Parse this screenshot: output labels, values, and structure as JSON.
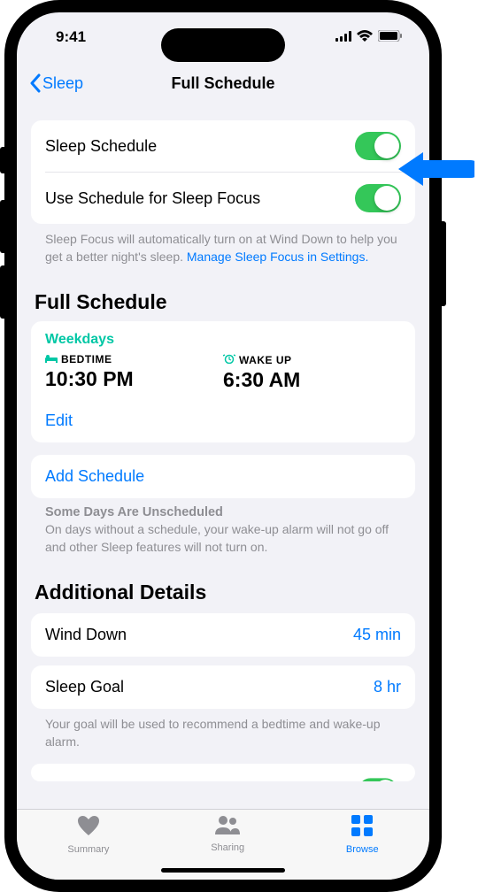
{
  "status": {
    "time": "9:41"
  },
  "nav": {
    "back": "Sleep",
    "title": "Full Schedule"
  },
  "toggles": {
    "sleep_schedule": {
      "label": "Sleep Schedule",
      "on": true
    },
    "use_focus": {
      "label": "Use Schedule for Sleep Focus",
      "on": true
    }
  },
  "focus_footer": {
    "text": "Sleep Focus will automatically turn on at Wind Down to help you get a better night's sleep. ",
    "link": "Manage Sleep Focus in Settings."
  },
  "section1": "Full Schedule",
  "schedule": {
    "name": "Weekdays",
    "bedtime_label": "BEDTIME",
    "bedtime": "10:30 PM",
    "wakeup_label": "WAKE UP",
    "wakeup": "6:30 AM",
    "edit": "Edit"
  },
  "add_schedule": "Add Schedule",
  "unscheduled": {
    "title": "Some Days Are Unscheduled",
    "body": "On days without a schedule, your wake-up alarm will not go off and other Sleep features will not turn on."
  },
  "section2": "Additional Details",
  "wind_down": {
    "label": "Wind Down",
    "value": "45 min"
  },
  "sleep_goal": {
    "label": "Sleep Goal",
    "value": "8 hr"
  },
  "goal_footer": "Your goal will be used to recommend a bedtime and wake-up alarm.",
  "tabs": {
    "summary": "Summary",
    "sharing": "Sharing",
    "browse": "Browse"
  }
}
